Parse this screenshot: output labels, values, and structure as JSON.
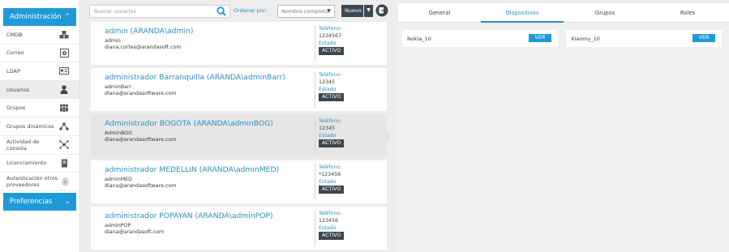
{
  "sidebar": {
    "admin_header": "Administración",
    "admin_chevron": "⌃",
    "items": [
      {
        "label": "CMDB",
        "icon": "cubes-icon"
      },
      {
        "label": "Correo",
        "icon": "mail-settings-icon"
      },
      {
        "label": "LDAP",
        "icon": "ldap-card-icon"
      },
      {
        "label": "Usuarios",
        "icon": "user-icon"
      },
      {
        "label": "Grupos",
        "icon": "group-icon"
      },
      {
        "label": "Grupos dinámicos",
        "icon": "dynamic-groups-icon"
      },
      {
        "label": "Actividad de consola",
        "icon": "console-activity-icon"
      },
      {
        "label": "Licenciamiento",
        "icon": "license-icon"
      },
      {
        "label": "Autenticación otros proveedores",
        "icon": "fingerprint-icon"
      }
    ],
    "prefs_header": "Preferencias",
    "prefs_chevron": "⌄"
  },
  "toolbar": {
    "search_placeholder": "Buscar usuarios",
    "order_label": "Ordenar por:",
    "order_value": "Nombre completo",
    "new_label": "Nuevo"
  },
  "users": [
    {
      "name": "admin (ARANDA\\admin)",
      "login": "admin",
      "email": "diana.cortes@arandasoft.com",
      "phone_label": "Teléfono:",
      "phone": "1234567",
      "status_label": "Estado",
      "status": "ACTIVO"
    },
    {
      "name": "administrador Barranquilla (ARANDA\\adminBarr)",
      "login": "adminBarr",
      "email": "diana@arandasoftware.com",
      "phone_label": "Teléfono:",
      "phone": "12345",
      "status_label": "Estado",
      "status": "ACTIVO"
    },
    {
      "name": "Administrador BOGOTA (ARANDA\\adminBOG)",
      "login": "AdminBOG",
      "email": "diana@arandasoftware.com",
      "phone_label": "Teléfono:",
      "phone": "12345",
      "status_label": "Estado",
      "status": "ACTIVO"
    },
    {
      "name": "administrador MEDELLIN (ARANDA\\adminMED)",
      "login": "adminMED",
      "email": "diana@arandasoftware.com",
      "phone_label": "Teléfono:",
      "phone": "*123456",
      "status_label": "Estado",
      "status": "ACTIVO"
    },
    {
      "name": "administrador POPAYAN (ARANDA\\adminPOP)",
      "login": "adminPOP",
      "email": "diana@arandasoft.com",
      "phone_label": "Teléfono:",
      "phone": "123456",
      "status_label": "Estado",
      "status": "ACTIVO"
    }
  ],
  "detail": {
    "tabs": [
      "General",
      "Dispositivos",
      "Grupos",
      "Roles"
    ],
    "active_tab": "Dispositivos",
    "devices": [
      {
        "name": "Nokia_10",
        "action": "VER"
      },
      {
        "name": "Xiaomy_10",
        "action": "VER"
      }
    ]
  },
  "colors": {
    "accent": "#1e9bd7",
    "link": "#2b8fc6",
    "dark": "#3c4750"
  }
}
